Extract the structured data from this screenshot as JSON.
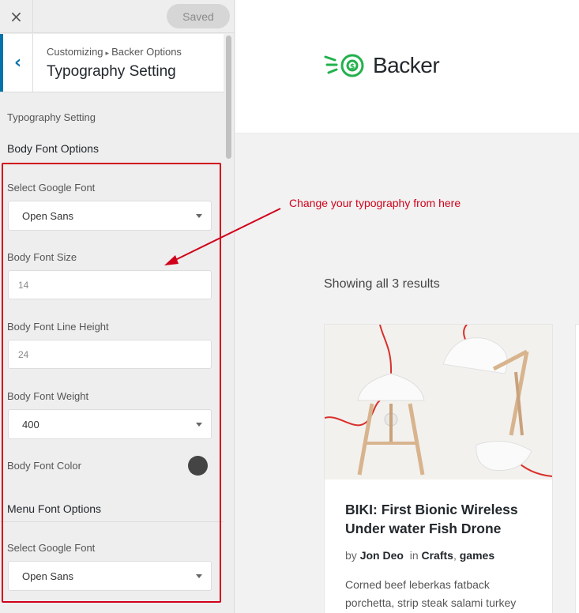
{
  "topbar": {
    "close_icon": "×",
    "saved_label": "Saved"
  },
  "section": {
    "back_icon": "‹",
    "breadcrumb_root": "Customizing",
    "breadcrumb_sep": "▸",
    "breadcrumb_parent": "Backer Options",
    "title": "Typography Setting"
  },
  "panel": {
    "group_label": "Typography Setting",
    "body_heading": "Body Font Options",
    "body_font_label": "Select Google Font",
    "body_font_value": "Open Sans",
    "font_size_label": "Body Font Size",
    "font_size_value": "14",
    "line_height_label": "Body Font Line Height",
    "line_height_value": "24",
    "font_weight_label": "Body Font Weight",
    "font_weight_value": "400",
    "font_color_label": "Body Font Color",
    "font_color_value": "#444444",
    "menu_heading": "Menu Font Options",
    "menu_font_label": "Select Google Font",
    "menu_font_value": "Open Sans"
  },
  "annotation": {
    "text": "Change your typography from here",
    "color": "#d0021b"
  },
  "preview": {
    "logo_text": "Backer",
    "brand_color": "#22b14c",
    "results_count": "Showing all 3 results",
    "product": {
      "title": "BIKI: First Bionic Wireless Under water Fish Drone",
      "by": "by",
      "author": "Jon Deo",
      "in": "in",
      "category1": "Crafts",
      "category_sep": ",",
      "category2": "games",
      "excerpt": "Corned beef leberkas fatback porchetta, strip steak salami turkey"
    }
  },
  "colors": {
    "accent": "#0073aa",
    "annotation": "#d0021b"
  }
}
